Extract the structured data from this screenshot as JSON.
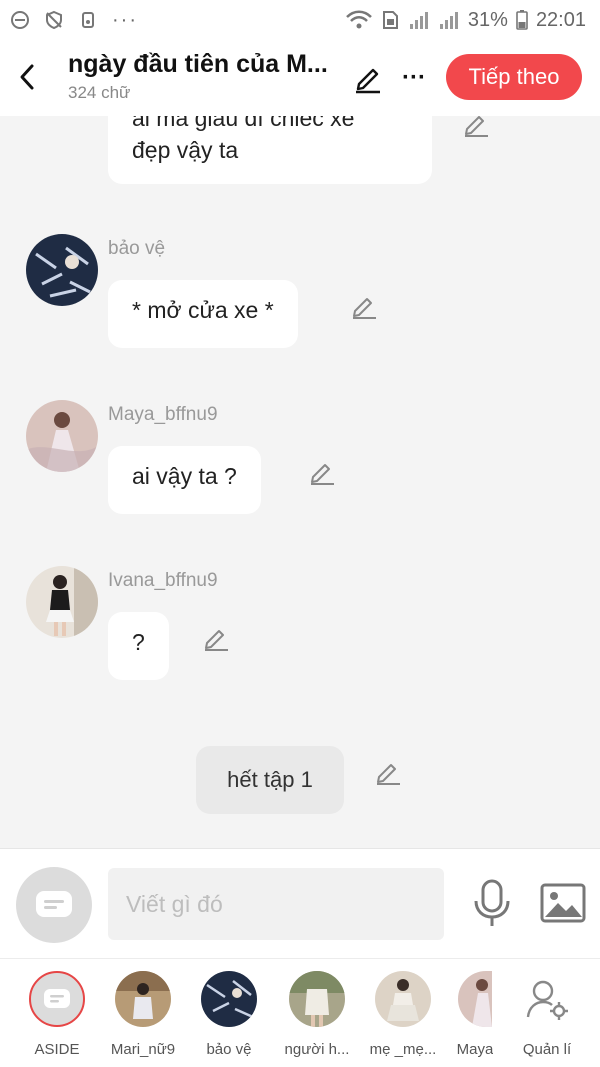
{
  "status_bar": {
    "battery": "31%",
    "time": "22:01",
    "more": "···"
  },
  "header": {
    "title": "ngày đầu tiên của M...",
    "word_count": "324 chữ",
    "next_label": "Tiếp theo",
    "more": "···"
  },
  "messages": [
    {
      "sender": "",
      "text_line1": "ai mà giàu dĩ chiếc xe",
      "text_line2": "đẹp vậy ta"
    },
    {
      "sender": "bảo vệ",
      "text": "* mở cửa xe *"
    },
    {
      "sender": "Maya_bffnu9",
      "text": "ai vậy ta ?"
    },
    {
      "sender": "Ivana_bffnu9",
      "text": "?"
    }
  ],
  "narration": {
    "text": "hết tập 1"
  },
  "composer": {
    "placeholder": "Viết gì đó"
  },
  "characters": [
    {
      "name": "ASIDE"
    },
    {
      "name": "Mari_nữ9"
    },
    {
      "name": "bảo vệ"
    },
    {
      "name": "người h..."
    },
    {
      "name": "mẹ _mẹ..."
    },
    {
      "name": "Maya"
    },
    {
      "name": "Quản lí"
    }
  ],
  "colors": {
    "accent": "#f2484c",
    "background": "#f4f4f4",
    "bubble": "#ffffff"
  }
}
